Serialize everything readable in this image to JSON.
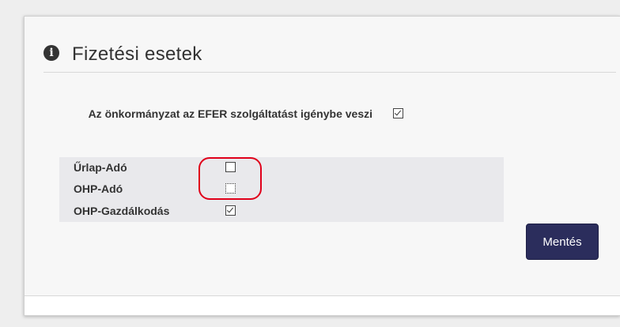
{
  "panel": {
    "title": "Fizetési esetek",
    "title_icon": "info-circle-icon"
  },
  "efer": {
    "label": "Az önkormányzat az EFER szolgáltatást igénybe veszi",
    "checked": true
  },
  "sub_options": [
    {
      "label": "Űrlap-Adó",
      "checked": false
    },
    {
      "label": "OHP-Adó",
      "checked": false
    },
    {
      "label": "OHP-Gazdálkodás",
      "checked": true
    }
  ],
  "actions": {
    "save_label": "Mentés"
  },
  "colors": {
    "button_bg": "#2b2d5c",
    "annotation": "#e0001a"
  }
}
